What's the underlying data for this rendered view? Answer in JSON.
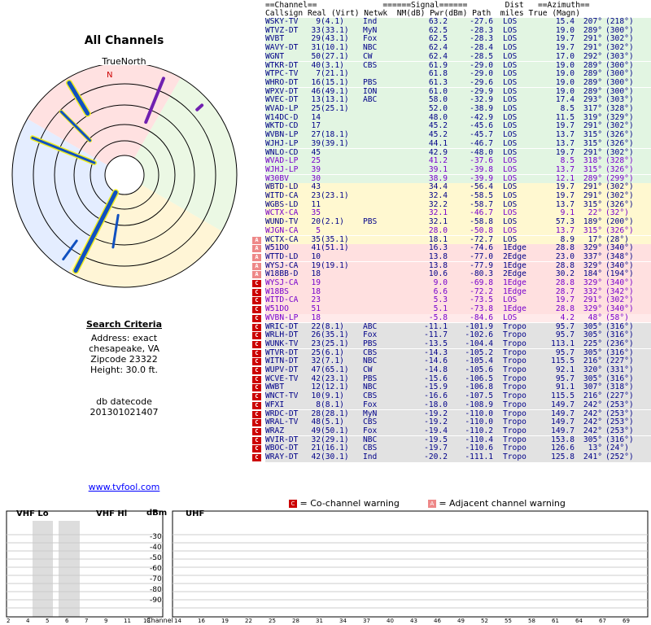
{
  "left": {
    "title": "All Channels",
    "true_north": "TrueNorth",
    "north": "N",
    "criteria_heading": "Search Criteria",
    "address": "Address: exact",
    "city": "chesapeake, VA",
    "zip": "Zipcode 23322",
    "height": "Height: 30.0 ft.",
    "db_label": "db datecode",
    "db_value": "201301021407",
    "site": "www.tvfool.com"
  },
  "headers": {
    "line1": "==Channel==              ======Signal======        Dist   ==Azimuth==",
    "line2": "Callsign Real (Virt) Netwk  NM(dB) Pwr(dBm) Path  miles True (Magn)"
  },
  "colors": {
    "green": "#e2f5e2",
    "yellow": "#fff8d0",
    "pink": "#ffe0e0",
    "lightred": "#ffeaea",
    "gray": "#e2e2e2"
  },
  "rows": [
    {
      "c": "WSKY-TV",
      "r": "9",
      "v": "(4.1)",
      "n": "Ind",
      "nm": "63.2",
      "p": "-27.6",
      "path": "LOS",
      "d": "15.4",
      "t": "207°",
      "m": "(218°)",
      "col": "#008",
      "bg": "green"
    },
    {
      "c": "WTVZ-DT",
      "r": "33",
      "v": "(33.1)",
      "n": "MyN",
      "nm": "62.5",
      "p": "-28.3",
      "path": "LOS",
      "d": "19.0",
      "t": "289°",
      "m": "(300°)",
      "col": "#008",
      "bg": "green"
    },
    {
      "c": "WVBT",
      "r": "29",
      "v": "(43.1)",
      "n": "Fox",
      "nm": "62.5",
      "p": "-28.3",
      "path": "LOS",
      "d": "19.7",
      "t": "291°",
      "m": "(302°)",
      "col": "#008",
      "bg": "green"
    },
    {
      "c": "WAVY-DT",
      "r": "31",
      "v": "(10.1)",
      "n": "NBC",
      "nm": "62.4",
      "p": "-28.4",
      "path": "LOS",
      "d": "19.7",
      "t": "291°",
      "m": "(302°)",
      "col": "#008",
      "bg": "green"
    },
    {
      "c": "WGNT",
      "r": "50",
      "v": "(27.1)",
      "n": "CW",
      "nm": "62.4",
      "p": "-28.5",
      "path": "LOS",
      "d": "17.0",
      "t": "292°",
      "m": "(303°)",
      "col": "#008",
      "bg": "green"
    },
    {
      "c": "WTKR-DT",
      "r": "40",
      "v": "(3.1)",
      "n": "CBS",
      "nm": "61.9",
      "p": "-29.0",
      "path": "LOS",
      "d": "19.0",
      "t": "289°",
      "m": "(300°)",
      "col": "#008",
      "bg": "green"
    },
    {
      "c": "WTPC-TV",
      "r": "7",
      "v": "(21.1)",
      "n": "",
      "nm": "61.8",
      "p": "-29.0",
      "path": "LOS",
      "d": "19.0",
      "t": "289°",
      "m": "(300°)",
      "col": "#008",
      "bg": "green"
    },
    {
      "c": "WHRO-DT",
      "r": "16",
      "v": "(15.1)",
      "n": "PBS",
      "nm": "61.3",
      "p": "-29.6",
      "path": "LOS",
      "d": "19.0",
      "t": "289°",
      "m": "(300°)",
      "col": "#008",
      "bg": "green"
    },
    {
      "c": "WPXV-DT",
      "r": "46",
      "v": "(49.1)",
      "n": "ION",
      "nm": "61.0",
      "p": "-29.9",
      "path": "LOS",
      "d": "19.0",
      "t": "289°",
      "m": "(300°)",
      "col": "#008",
      "bg": "green"
    },
    {
      "c": "WVEC-DT",
      "r": "13",
      "v": "(13.1)",
      "n": "ABC",
      "nm": "58.0",
      "p": "-32.9",
      "path": "LOS",
      "d": "17.4",
      "t": "293°",
      "m": "(303°)",
      "col": "#008",
      "bg": "green"
    },
    {
      "c": "WVAD-LP",
      "r": "25",
      "v": "(25.1)",
      "n": "",
      "nm": "52.0",
      "p": "-38.9",
      "path": "LOS",
      "d": "8.5",
      "t": "317°",
      "m": "(328°)",
      "col": "#008",
      "bg": "green"
    },
    {
      "c": "W14DC-D",
      "r": "14",
      "v": "",
      "n": "",
      "nm": "48.0",
      "p": "-42.9",
      "path": "LOS",
      "d": "11.5",
      "t": "319°",
      "m": "(329°)",
      "col": "#008",
      "bg": "green"
    },
    {
      "c": "WKTD-CD",
      "r": "17",
      "v": "",
      "n": "",
      "nm": "45.2",
      "p": "-45.6",
      "path": "LOS",
      "d": "19.7",
      "t": "291°",
      "m": "(302°)",
      "col": "#008",
      "bg": "green"
    },
    {
      "c": "WVBN-LP",
      "r": "27",
      "v": "(18.1)",
      "n": "",
      "nm": "45.2",
      "p": "-45.7",
      "path": "LOS",
      "d": "13.7",
      "t": "315°",
      "m": "(326°)",
      "col": "#008",
      "bg": "green"
    },
    {
      "c": "WJHJ-LP",
      "r": "39",
      "v": "(39.1)",
      "n": "",
      "nm": "44.1",
      "p": "-46.7",
      "path": "LOS",
      "d": "13.7",
      "t": "315°",
      "m": "(326°)",
      "col": "#008",
      "bg": "green"
    },
    {
      "c": "WNLO-CD",
      "r": "45",
      "v": "",
      "n": "",
      "nm": "42.9",
      "p": "-48.0",
      "path": "LOS",
      "d": "19.7",
      "t": "291°",
      "m": "(302°)",
      "col": "#008",
      "bg": "green"
    },
    {
      "c": "WVAD-LP",
      "r": "25",
      "v": "",
      "n": "",
      "nm": "41.2",
      "p": "-37.6",
      "path": "LOS",
      "d": "8.5",
      "t": "318°",
      "m": "(328°)",
      "col": "#70c",
      "bg": "green"
    },
    {
      "c": "WJHJ-LP",
      "r": "39",
      "v": "",
      "n": "",
      "nm": "39.1",
      "p": "-39.8",
      "path": "LOS",
      "d": "13.7",
      "t": "315°",
      "m": "(326°)",
      "col": "#70c",
      "bg": "green"
    },
    {
      "c": "W30BV",
      "r": "30",
      "v": "",
      "n": "",
      "nm": "38.9",
      "p": "-39.9",
      "path": "LOS",
      "d": "12.1",
      "t": "289°",
      "m": "(299°)",
      "col": "#70c",
      "bg": "green"
    },
    {
      "c": "WBTD-LD",
      "r": "43",
      "v": "",
      "n": "",
      "nm": "34.4",
      "p": "-56.4",
      "path": "LOS",
      "d": "19.7",
      "t": "291°",
      "m": "(302°)",
      "col": "#008",
      "bg": "yellow"
    },
    {
      "c": "WITD-CA",
      "r": "23",
      "v": "(23.1)",
      "n": "",
      "nm": "32.4",
      "p": "-58.5",
      "path": "LOS",
      "d": "19.7",
      "t": "291°",
      "m": "(302°)",
      "col": "#008",
      "bg": "yellow"
    },
    {
      "c": "WGBS-LD",
      "r": "11",
      "v": "",
      "n": "",
      "nm": "32.2",
      "p": "-58.7",
      "path": "LOS",
      "d": "13.7",
      "t": "315°",
      "m": "(326°)",
      "col": "#008",
      "bg": "yellow"
    },
    {
      "c": "WCTX-CA",
      "r": "35",
      "v": "",
      "n": "",
      "nm": "32.1",
      "p": "-46.7",
      "path": "LOS",
      "d": "9.1",
      "t": "22°",
      "m": "(32°)",
      "col": "#70c",
      "bg": "yellow"
    },
    {
      "c": "WUND-TV",
      "r": "20",
      "v": "(2.1)",
      "n": "PBS",
      "nm": "32.1",
      "p": "-58.8",
      "path": "LOS",
      "d": "57.3",
      "t": "189°",
      "m": "(200°)",
      "col": "#008",
      "bg": "yellow"
    },
    {
      "c": "WJGN-CA",
      "r": "5",
      "v": "",
      "n": "",
      "nm": "28.0",
      "p": "-50.8",
      "path": "LOS",
      "d": "13.7",
      "t": "315°",
      "m": "(326°)",
      "col": "#70c",
      "bg": "yellow"
    },
    {
      "c": "WCTX-CA",
      "r": "35",
      "v": "(35.1)",
      "n": "",
      "nm": "18.1",
      "p": "-72.7",
      "path": "LOS",
      "d": "8.9",
      "t": "17°",
      "m": "(28°)",
      "col": "#008",
      "bg": "yellow",
      "badge": "adj"
    },
    {
      "c": "W51DO",
      "r": "41",
      "v": "(51.1)",
      "n": "",
      "nm": "16.3",
      "p": "-74.6",
      "path": "1Edge",
      "d": "28.8",
      "t": "329°",
      "m": "(340°)",
      "col": "#008",
      "bg": "pink",
      "badge": "adj"
    },
    {
      "c": "WTTD-LD",
      "r": "10",
      "v": "",
      "n": "",
      "nm": "13.8",
      "p": "-77.0",
      "path": "2Edge",
      "d": "23.0",
      "t": "337°",
      "m": "(348°)",
      "col": "#008",
      "bg": "pink",
      "badge": "adj"
    },
    {
      "c": "WYSJ-CA",
      "r": "19",
      "v": "(19.1)",
      "n": "",
      "nm": "13.8",
      "p": "-77.9",
      "path": "1Edge",
      "d": "28.8",
      "t": "329°",
      "m": "(340°)",
      "col": "#008",
      "bg": "pink",
      "badge": "adj"
    },
    {
      "c": "W18BB-D",
      "r": "18",
      "v": "",
      "n": "",
      "nm": "10.6",
      "p": "-80.3",
      "path": "2Edge",
      "d": "30.2",
      "t": "184°",
      "m": "(194°)",
      "col": "#008",
      "bg": "pink",
      "badge": "adj"
    },
    {
      "c": "WYSJ-CA",
      "r": "19",
      "v": "",
      "n": "",
      "nm": "9.0",
      "p": "-69.8",
      "path": "1Edge",
      "d": "28.8",
      "t": "329°",
      "m": "(340°)",
      "col": "#70c",
      "bg": "pink",
      "badge": "co"
    },
    {
      "c": "W18BS",
      "r": "18",
      "v": "",
      "n": "",
      "nm": "6.6",
      "p": "-72.2",
      "path": "1Edge",
      "d": "28.7",
      "t": "332°",
      "m": "(342°)",
      "col": "#70c",
      "bg": "pink",
      "badge": "co"
    },
    {
      "c": "WITD-CA",
      "r": "23",
      "v": "",
      "n": "",
      "nm": "5.3",
      "p": "-73.5",
      "path": "LOS",
      "d": "19.7",
      "t": "291°",
      "m": "(302°)",
      "col": "#70c",
      "bg": "pink",
      "badge": "co"
    },
    {
      "c": "W51DO",
      "r": "51",
      "v": "",
      "n": "",
      "nm": "5.1",
      "p": "-73.8",
      "path": "1Edge",
      "d": "28.8",
      "t": "329°",
      "m": "(340°)",
      "col": "#70c",
      "bg": "pink",
      "badge": "co"
    },
    {
      "c": "WVBN-LP",
      "r": "18",
      "v": "",
      "n": "",
      "nm": "-5.8",
      "p": "-84.6",
      "path": "LOS",
      "d": "4.2",
      "t": "48°",
      "m": "(58°)",
      "col": "#70c",
      "bg": "lightred",
      "badge": "co"
    },
    {
      "c": "WRIC-DT",
      "r": "22",
      "v": "(8.1)",
      "n": "ABC",
      "nm": "-11.1",
      "p": "-101.9",
      "path": "Tropo",
      "d": "95.7",
      "t": "305°",
      "m": "(316°)",
      "col": "#008",
      "bg": "gray",
      "badge": "co"
    },
    {
      "c": "WRLH-DT",
      "r": "26",
      "v": "(35.1)",
      "n": "Fox",
      "nm": "-11.7",
      "p": "-102.6",
      "path": "Tropo",
      "d": "95.7",
      "t": "305°",
      "m": "(316°)",
      "col": "#008",
      "bg": "gray",
      "badge": "co"
    },
    {
      "c": "WUNK-TV",
      "r": "23",
      "v": "(25.1)",
      "n": "PBS",
      "nm": "-13.5",
      "p": "-104.4",
      "path": "Tropo",
      "d": "113.1",
      "t": "225°",
      "m": "(236°)",
      "col": "#008",
      "bg": "gray",
      "badge": "co"
    },
    {
      "c": "WTVR-DT",
      "r": "25",
      "v": "(6.1)",
      "n": "CBS",
      "nm": "-14.3",
      "p": "-105.2",
      "path": "Tropo",
      "d": "95.7",
      "t": "305°",
      "m": "(316°)",
      "col": "#008",
      "bg": "gray",
      "badge": "co"
    },
    {
      "c": "WITN-DT",
      "r": "32",
      "v": "(7.1)",
      "n": "NBC",
      "nm": "-14.6",
      "p": "-105.4",
      "path": "Tropo",
      "d": "115.5",
      "t": "216°",
      "m": "(227°)",
      "col": "#008",
      "bg": "gray",
      "badge": "co"
    },
    {
      "c": "WUPV-DT",
      "r": "47",
      "v": "(65.1)",
      "n": "CW",
      "nm": "-14.8",
      "p": "-105.6",
      "path": "Tropo",
      "d": "92.1",
      "t": "320°",
      "m": "(331°)",
      "col": "#008",
      "bg": "gray",
      "badge": "co"
    },
    {
      "c": "WCVE-TV",
      "r": "42",
      "v": "(23.1)",
      "n": "PBS",
      "nm": "-15.6",
      "p": "-106.5",
      "path": "Tropo",
      "d": "95.7",
      "t": "305°",
      "m": "(316°)",
      "col": "#008",
      "bg": "gray",
      "badge": "co"
    },
    {
      "c": "WWBT",
      "r": "12",
      "v": "(12.1)",
      "n": "NBC",
      "nm": "-15.9",
      "p": "-106.8",
      "path": "Tropo",
      "d": "91.1",
      "t": "307°",
      "m": "(318°)",
      "col": "#008",
      "bg": "gray",
      "badge": "co"
    },
    {
      "c": "WNCT-TV",
      "r": "10",
      "v": "(9.1)",
      "n": "CBS",
      "nm": "-16.6",
      "p": "-107.5",
      "path": "Tropo",
      "d": "115.5",
      "t": "216°",
      "m": "(227°)",
      "col": "#008",
      "bg": "gray",
      "badge": "co"
    },
    {
      "c": "WFXI",
      "r": "8",
      "v": "(8.1)",
      "n": "Fox",
      "nm": "-18.0",
      "p": "-108.9",
      "path": "Tropo",
      "d": "149.7",
      "t": "242°",
      "m": "(253°)",
      "col": "#008",
      "bg": "gray",
      "badge": "co"
    },
    {
      "c": "WRDC-DT",
      "r": "28",
      "v": "(28.1)",
      "n": "MyN",
      "nm": "-19.2",
      "p": "-110.0",
      "path": "Tropo",
      "d": "149.7",
      "t": "242°",
      "m": "(253°)",
      "col": "#008",
      "bg": "gray",
      "badge": "co"
    },
    {
      "c": "WRAL-TV",
      "r": "48",
      "v": "(5.1)",
      "n": "CBS",
      "nm": "-19.2",
      "p": "-110.0",
      "path": "Tropo",
      "d": "149.7",
      "t": "242°",
      "m": "(253°)",
      "col": "#008",
      "bg": "gray",
      "badge": "co"
    },
    {
      "c": "WRAZ",
      "r": "49",
      "v": "(50.1)",
      "n": "Fox",
      "nm": "-19.4",
      "p": "-110.2",
      "path": "Tropo",
      "d": "149.7",
      "t": "242°",
      "m": "(253°)",
      "col": "#008",
      "bg": "gray",
      "badge": "co"
    },
    {
      "c": "WVIR-DT",
      "r": "32",
      "v": "(29.1)",
      "n": "NBC",
      "nm": "-19.5",
      "p": "-110.4",
      "path": "Tropo",
      "d": "153.8",
      "t": "305°",
      "m": "(316°)",
      "col": "#008",
      "bg": "gray",
      "badge": "co"
    },
    {
      "c": "WBOC-DT",
      "r": "21",
      "v": "(16.1)",
      "n": "CBS",
      "nm": "-19.7",
      "p": "-110.6",
      "path": "Tropo",
      "d": "126.6",
      "t": "13°",
      "m": "(24°)",
      "col": "#008",
      "bg": "gray",
      "badge": "co"
    },
    {
      "c": "WRAY-DT",
      "r": "42",
      "v": "(30.1)",
      "n": "Ind",
      "nm": "-20.2",
      "p": "-111.1",
      "path": "Tropo",
      "d": "125.8",
      "t": "241°",
      "m": "(252°)",
      "col": "#008",
      "bg": "gray",
      "badge": "co"
    }
  ],
  "legend": {
    "co": "= Co-channel warning",
    "adj": "= Adjacent channel warning",
    "co_icon": "C",
    "adj_icon": "A"
  },
  "band": {
    "vhf_lo": "VHF Lo",
    "vhf_hi": "VHF Hi",
    "uhf": "UHF",
    "dbm": "dBm",
    "channel": "Channel",
    "dbm_ticks": [
      "-30",
      "-40",
      "-50",
      "-60",
      "-70",
      "-80",
      "-90"
    ],
    "ch_ticks": [
      "2",
      "4",
      "5",
      "6",
      "7",
      "9",
      "11",
      "13",
      "14",
      "16",
      "19",
      "22",
      "25",
      "28",
      "31",
      "34",
      "37",
      "40",
      "43",
      "46",
      "49",
      "52",
      "55",
      "58",
      "61",
      "64",
      "67",
      "69"
    ]
  }
}
